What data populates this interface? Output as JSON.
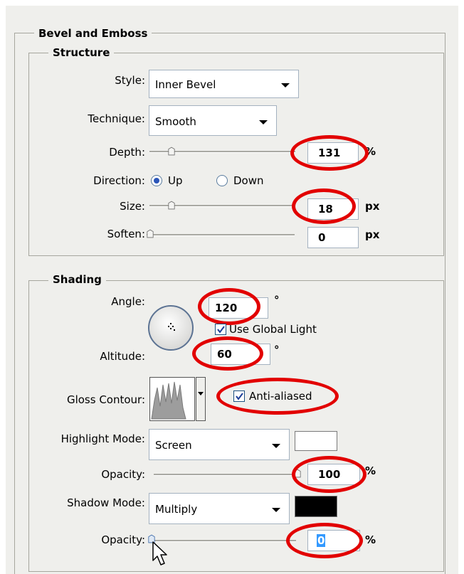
{
  "panel": {
    "title": "Bevel and Emboss",
    "structure": {
      "legend": "Structure",
      "style": {
        "label": "Style:",
        "value": "Inner Bevel"
      },
      "technique": {
        "label": "Technique:",
        "value": "Smooth"
      },
      "depth": {
        "label": "Depth:",
        "value": "131",
        "unit": "%"
      },
      "direction": {
        "label": "Direction:",
        "options": [
          "Up",
          "Down"
        ],
        "selected": "Up"
      },
      "size": {
        "label": "Size:",
        "value": "18",
        "unit": "px"
      },
      "soften": {
        "label": "Soften:",
        "value": "0",
        "unit": "px"
      }
    },
    "shading": {
      "legend": "Shading",
      "angle": {
        "label": "Angle:",
        "value": "120",
        "unit": "°"
      },
      "global_light": {
        "label": "Use Global Light",
        "checked": true
      },
      "altitude": {
        "label": "Altitude:",
        "value": "60",
        "unit": "°"
      },
      "gloss_contour": {
        "label": "Gloss Contour:"
      },
      "anti_aliased": {
        "label": "Anti-aliased",
        "checked": true
      },
      "highlight_mode": {
        "label": "Highlight Mode:",
        "value": "Screen",
        "color": "#ffffff"
      },
      "highlight_opacity": {
        "label": "Opacity:",
        "value": "100",
        "unit": "%"
      },
      "shadow_mode": {
        "label": "Shadow Mode:",
        "value": "Multiply",
        "color": "#000000"
      },
      "shadow_opacity": {
        "label": "Opacity:",
        "value": "0",
        "unit": "%"
      }
    }
  },
  "annotation_color": "#e20000"
}
